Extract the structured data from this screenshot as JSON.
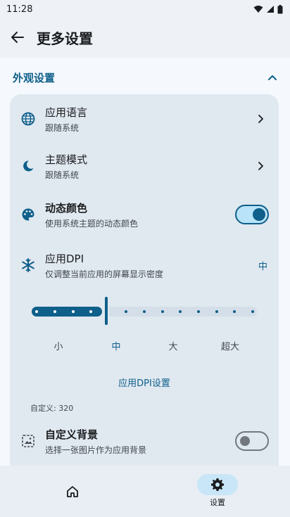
{
  "status_bar": {
    "time": "11:28"
  },
  "topbar": {
    "title": "更多设置"
  },
  "section": {
    "title": "外观设置"
  },
  "settings": {
    "language": {
      "title": "应用语言",
      "subtitle": "跟随系统"
    },
    "theme": {
      "title": "主题模式",
      "subtitle": "跟随系统"
    },
    "dynamic_color": {
      "title": "动态颜色",
      "subtitle": "使用系统主题的动态颜色",
      "enabled": true
    },
    "dpi": {
      "title": "应用DPI",
      "subtitle": "仅调整当前应用的屏幕显示密度",
      "value": "中",
      "levels": [
        "小",
        "中",
        "大",
        "超大"
      ],
      "selected_index": 1,
      "link": "应用DPI设置",
      "custom_note": "自定义: 320"
    },
    "custom_bg": {
      "title": "自定义背景",
      "subtitle": "选择一张图片作为应用背景",
      "enabled": false
    }
  },
  "bottom_nav": {
    "items": [
      {
        "icon": "home-icon",
        "label": ""
      },
      {
        "icon": "gear-icon",
        "label": "设置",
        "active": true
      }
    ]
  },
  "colors": {
    "accent": "#0e5f8a",
    "card": "#e0e8f0",
    "background": "#f5f8fc"
  }
}
